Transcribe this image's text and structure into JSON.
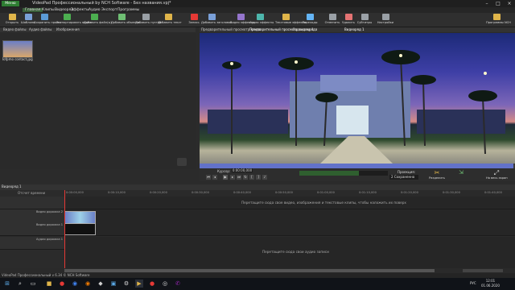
{
  "window": {
    "title": "VideoPad Профессиональный by NCH Software - Без названия.vpj*",
    "menu_button": "Меню"
  },
  "menubar": [
    "Главная",
    "Клипы",
    "Видеоряд",
    "Эффекты",
    "Аудио",
    "Экспорт",
    "Программы"
  ],
  "toolbar": [
    {
      "label": "Открыть",
      "icon": "folder-open-icon",
      "color": "#e0b54a"
    },
    {
      "label": "Шаблоны",
      "icon": "template-icon",
      "color": "#7aa0d8"
    },
    {
      "label": "Сохранить проект",
      "icon": "save-icon",
      "color": "#5b9bd5"
    },
    {
      "label": "Экспортировать видео",
      "icon": "export-video-icon",
      "color": "#4caf50"
    },
    {
      "label": "Добавить файл(ы)",
      "icon": "add-file-icon",
      "color": "#4caf50"
    },
    {
      "label": "Добавить объекты",
      "icon": "add-objects-icon",
      "color": "#6fbf73"
    },
    {
      "label": "Добавить пустой",
      "icon": "add-blank-icon",
      "color": "#9aa0a6"
    },
    {
      "label": "Добавить текст",
      "icon": "add-text-icon",
      "color": "#e0b54a"
    },
    {
      "label": "Запись",
      "icon": "record-icon",
      "color": "#e53935"
    },
    {
      "label": "Добавить заголовок",
      "icon": "add-title-icon",
      "color": "#7aa0d8"
    },
    {
      "label": "Видео эффекты",
      "icon": "video-effects-icon",
      "color": "#9575cd"
    },
    {
      "label": "Аудио эффекты",
      "icon": "audio-effects-icon",
      "color": "#4db6ac"
    },
    {
      "label": "Текстовые эффекты",
      "icon": "text-effects-icon",
      "color": "#e0b54a"
    },
    {
      "label": "Переходы",
      "icon": "transitions-icon",
      "color": "#64b5f6"
    },
    {
      "label": "Отменить",
      "icon": "undo-icon",
      "color": "#9aa0a6"
    },
    {
      "label": "Удалить",
      "icon": "delete-icon",
      "color": "#e57373"
    },
    {
      "label": "Субтитры",
      "icon": "subtitles-icon",
      "color": "#9aa0a6"
    },
    {
      "label": "Настройки",
      "icon": "settings-icon",
      "color": "#9aa0a6"
    },
    {
      "label": "Программы NCH",
      "icon": "nch-suite-icon",
      "color": "#e0b54a"
    }
  ],
  "bin": {
    "tabs": [
      "Видео файлы",
      "Аудио файлы",
      "Изображения"
    ],
    "file_name": "Iofpmo contact.jpg"
  },
  "preview": {
    "tabs": [
      "Предварительный просмотр клипа",
      "Предварительный просмотр видеоряда",
      "Видео ряд 1"
    ],
    "sequence_tab": "Видеоряд 1",
    "cursor_label": "Курсор:",
    "cursor_time": "0:00:00,000"
  },
  "transport": {
    "projection_label": "Проекция:",
    "projection_value": "2 Сохраненно",
    "split_label": "Разделить",
    "unlink_label": "",
    "fullscreen_label": "На весь экран"
  },
  "timeline": {
    "tab": "Видеоряд 1",
    "ruler_label": "Отсчет времени",
    "ticks": [
      "0:00:00,000",
      "0:00:10,000",
      "0:00:20,000",
      "0:00:30,000",
      "0:00:40,000",
      "0:00:50,000",
      "0:01:00,000",
      "0:01:10,000",
      "0:01:20,000",
      "0:01:30,000",
      "0:01:40,000"
    ],
    "tracks": [
      {
        "name": "Видео дорожка 2"
      },
      {
        "name": "Видео дорожка 1"
      },
      {
        "name": "Аудио дорожка 1"
      }
    ],
    "overlay_hint": "Перетащите сюда свое видео, изображения и текстовые клипы, чтобы наложить их поверх",
    "audio_hint": "Перетащите сюда свои аудио записи"
  },
  "status": {
    "text": "VideoPad Профессиональный v 6.34 © NCH Software"
  },
  "taskbar": {
    "lang": "РУС",
    "time": "12:01",
    "date": "01.06.2020"
  }
}
